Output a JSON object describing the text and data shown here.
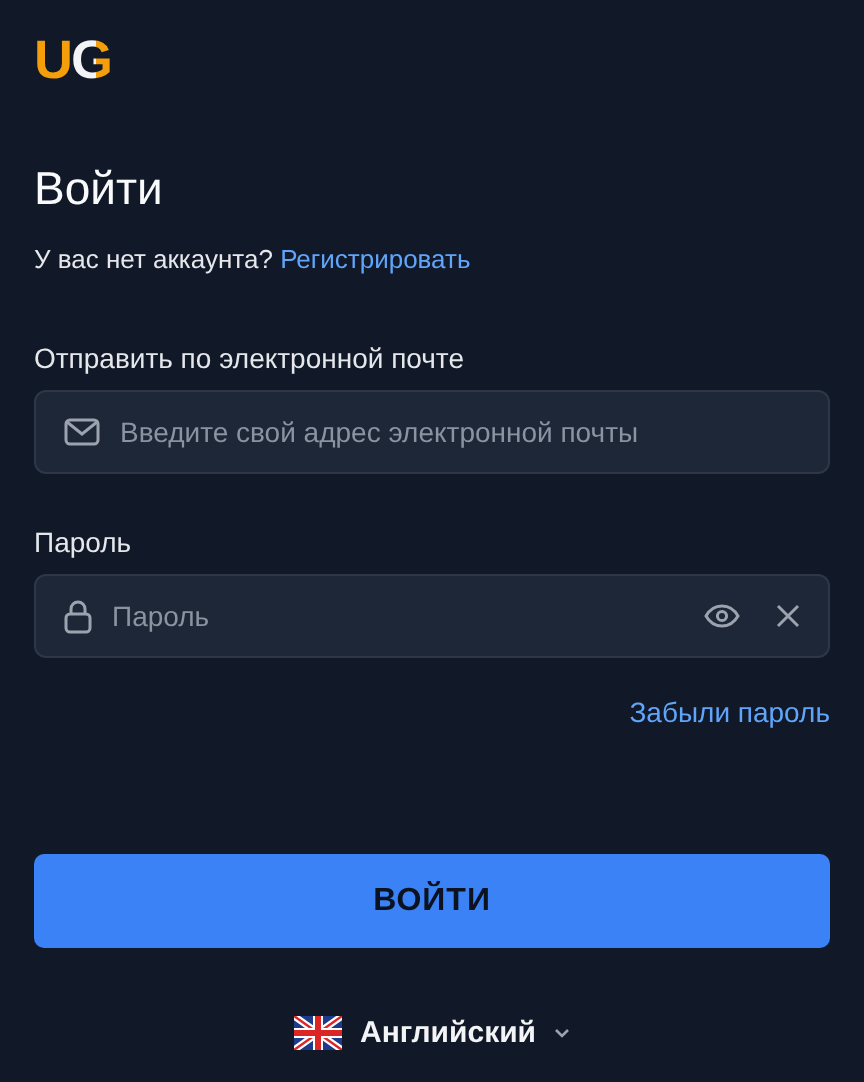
{
  "logo": "UG",
  "title": "Войти",
  "signup_prompt": {
    "text": "У вас нет аккаунта?",
    "link": "Регистрировать"
  },
  "fields": [
    {
      "kind": "email",
      "label": "Отправить по электронной почте",
      "placeholder": "Введите свой адрес электронной почты"
    },
    {
      "kind": "password",
      "label": "Пароль",
      "placeholder": "Пароль"
    }
  ],
  "forgot_link": "Забыли пароль",
  "submit_button": "ВОЙТИ",
  "language": "Английский"
}
